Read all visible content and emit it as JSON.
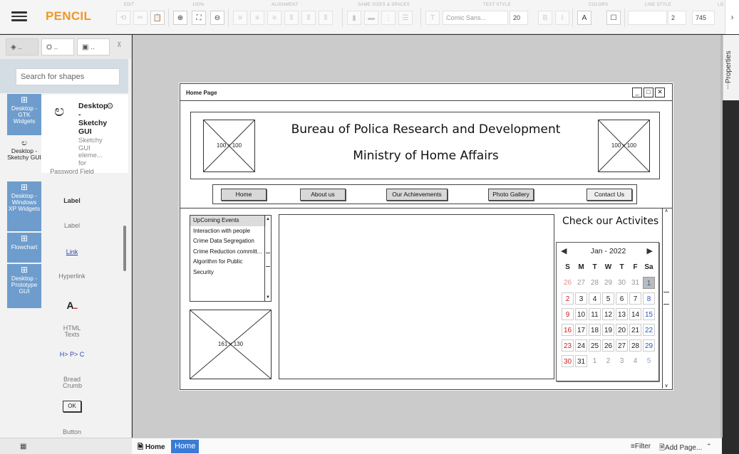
{
  "app": {
    "name": "PENCIL"
  },
  "toolbar": {
    "groups": [
      "EDIT",
      "100%",
      "ALIGNMENT",
      "SAME SIZES & SPACES",
      "TEXT STYLE",
      "COLORS",
      "LINE STYLE",
      "LO"
    ],
    "font_name": "Comic Sans...",
    "font_size": "20",
    "line_width": "2",
    "value_745": "745"
  },
  "sidebar": {
    "search_placeholder": "Search for shapes",
    "categories": [
      {
        "label": "Desktop - GTK Widgets",
        "icon": "grid-icon"
      },
      {
        "label": "Desktop - Sketchy GUI",
        "icon": "squiggle-icon"
      },
      {
        "label": "Desktop - Windows XP Widgets",
        "icon": "grid-icon"
      },
      {
        "label": "Flowchart",
        "icon": "grid-icon"
      },
      {
        "label": "Desktop - Prototype GUI",
        "icon": "grid-icon"
      }
    ],
    "library": {
      "title": "Desktop - Sketchy GUI",
      "description": "Sketchy GUI eleme... for"
    },
    "shapes": [
      {
        "label": "Password Field"
      },
      {
        "label": "Label",
        "preview": "Label"
      },
      {
        "label": "Hyperlink",
        "preview": "Link"
      },
      {
        "label": "HTML Texts"
      },
      {
        "label": "Bread Crumb",
        "preview": "H> P> C"
      },
      {
        "label": "Button",
        "preview": "OK"
      }
    ]
  },
  "mockup": {
    "window_title": "Home Page",
    "placeholder_left": "100 x 100",
    "placeholder_right": "100 x 100",
    "header_line1": "Bureau of Polica Research and Development",
    "header_line2": "Ministry of Home Affairs",
    "nav": [
      "Home",
      "About us",
      "Our Achievements",
      "Photo Gallery",
      "Contact Us"
    ],
    "events": [
      "UpComing Events",
      "Interaction with people",
      "Crime Data Segregation",
      "Crime Reduction committ...",
      "Algorithm for Public",
      "Security"
    ],
    "image_placeholder": "161 x 130",
    "activities_title": "Check our Activites",
    "calendar": {
      "month": "Jan - 2022",
      "days": [
        "S",
        "M",
        "T",
        "W",
        "T",
        "F",
        "Sa"
      ],
      "weeks": [
        [
          "26",
          "27",
          "28",
          "29",
          "30",
          "31",
          "1"
        ],
        [
          "2",
          "3",
          "4",
          "5",
          "6",
          "7",
          "8"
        ],
        [
          "9",
          "10",
          "11",
          "12",
          "13",
          "14",
          "15"
        ],
        [
          "16",
          "17",
          "18",
          "19",
          "20",
          "21",
          "22"
        ],
        [
          "23",
          "24",
          "25",
          "26",
          "27",
          "28",
          "29"
        ],
        [
          "30",
          "31",
          "1",
          "2",
          "3",
          "4",
          "5"
        ]
      ],
      "selected": "1"
    }
  },
  "properties": {
    "label": "Properties"
  },
  "bottombar": {
    "page_label": "Home",
    "active_page": "Home",
    "filter": "Filter",
    "add_page": "Add Page..."
  }
}
